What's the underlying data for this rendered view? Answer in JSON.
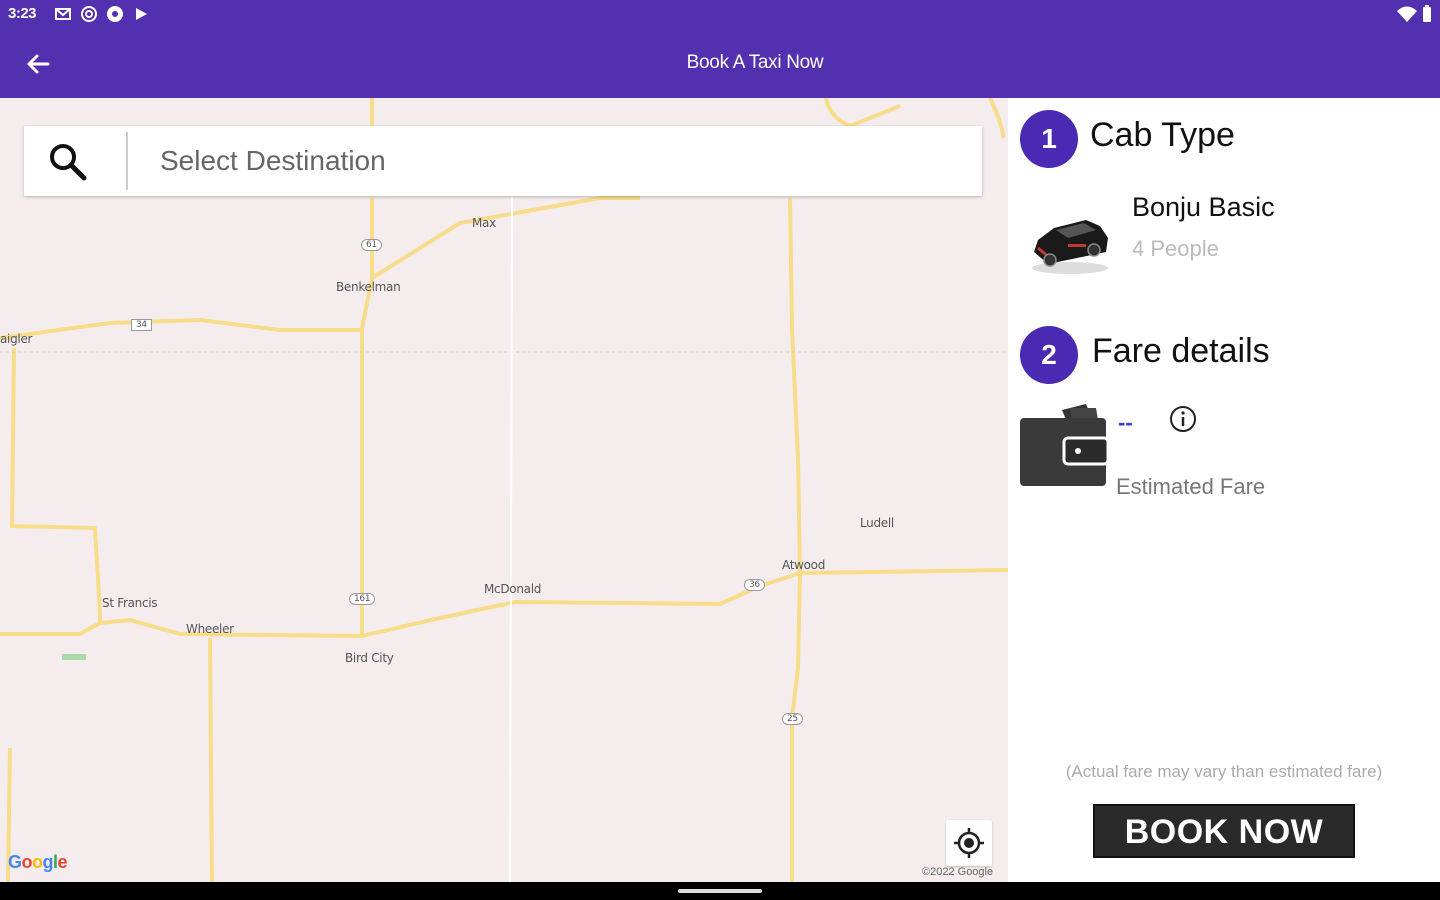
{
  "status_bar": {
    "time": "3:23",
    "icons": [
      "gmail-icon",
      "at-icon",
      "soccer-icon",
      "play-icon"
    ],
    "right_icons": [
      "wifi-icon",
      "battery-icon"
    ]
  },
  "app_bar": {
    "title": "Book A Taxi Now",
    "back_icon": "arrow-left-icon"
  },
  "search": {
    "placeholder": "Select Destination",
    "value": ""
  },
  "map": {
    "labels": {
      "max": "Max",
      "benkelman": "Benkelman",
      "haigler": "aigler",
      "st_francis": "St Francis",
      "wheeler": "Wheeler",
      "bird_city": "Bird City",
      "mcdonald": "McDonald",
      "atwood": "Atwood",
      "ludell": "Ludell"
    },
    "route_shields": {
      "r61": "61",
      "r34": "34",
      "r161": "161",
      "r36": "36",
      "r25": "25"
    },
    "google": "Google",
    "copyright": "©2022 Google"
  },
  "cab_type": {
    "step": "1",
    "title": "Cab Type",
    "name": "Bonju Basic",
    "capacity": "4 People"
  },
  "fare": {
    "step": "2",
    "title": "Fare details",
    "value": "--",
    "label": "Estimated Fare",
    "note": "(Actual fare may vary than estimated fare)"
  },
  "actions": {
    "book_label": "BOOK NOW"
  },
  "colors": {
    "primary": "#5230b0",
    "step_circle": "#4a2ab3",
    "map_bg": "#f5eded",
    "road": "#f7dc8a",
    "book_button": "#2a2a2a"
  }
}
